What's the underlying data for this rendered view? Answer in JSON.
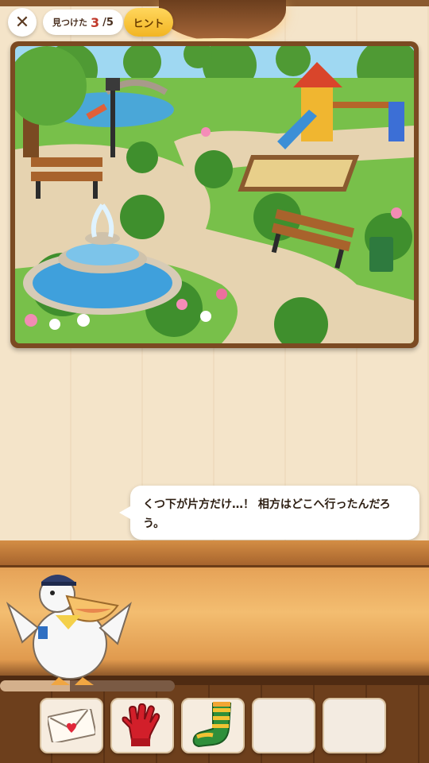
{
  "header": {
    "close_symbol": "✕",
    "found_label": "見つけた",
    "found_count": "3",
    "found_total": "/5",
    "hint_label": "ヒント"
  },
  "dialogue": {
    "text": "くつ下が片方だけ…！ 相方はどこへ行ったんだろう。"
  },
  "progress": {
    "fraction": 0.4
  },
  "inventory": {
    "slots": [
      {
        "item": "envelope-icon",
        "filled": true
      },
      {
        "item": "red-glove-icon",
        "filled": true
      },
      {
        "item": "striped-sock-icon",
        "filled": true
      },
      {
        "item": "",
        "filled": false
      },
      {
        "item": "",
        "filled": false
      }
    ]
  },
  "colors": {
    "accent": "#f2b523",
    "count": "#c0392b",
    "frame": "#7b4a22"
  }
}
